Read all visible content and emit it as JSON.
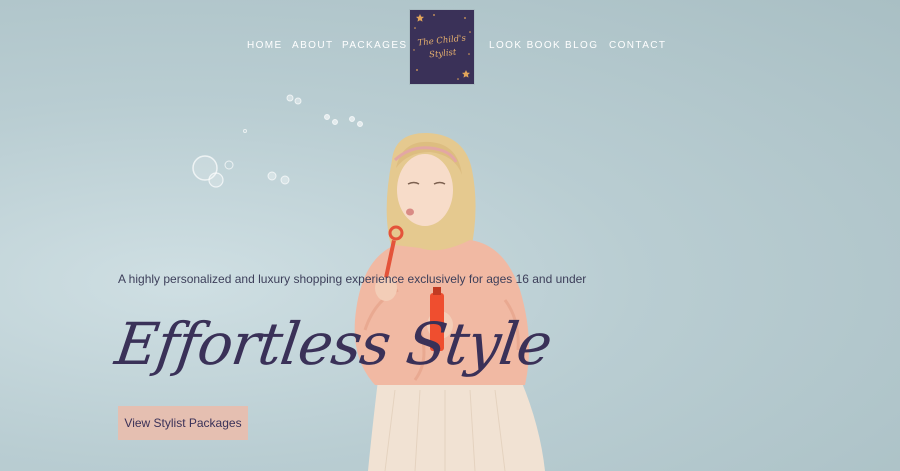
{
  "nav": {
    "left": [
      "HOME",
      "ABOUT",
      "PACKAGES"
    ],
    "right": [
      "LOOK BOOK",
      "BLOG",
      "CONTACT"
    ]
  },
  "logo": {
    "text": "The Child's Stylist"
  },
  "hero": {
    "tagline": "A highly personalized and luxury shopping experience exclusively for ages 16 and under",
    "headline": "Effortless Style",
    "cta_label": "View Stylist Packages"
  },
  "colors": {
    "brand_purple": "#3a3158",
    "button_pink": "#e5bfb1",
    "background": "#b9cdd2"
  }
}
